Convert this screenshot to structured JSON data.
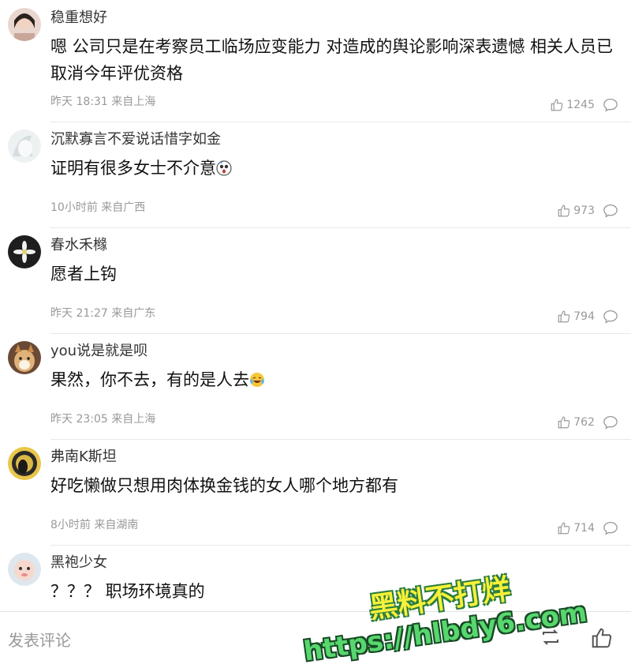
{
  "comments": [
    {
      "username": "稳重想好",
      "content": "嗯 公司只是在考察员工临场应变能力 对造成的舆论影响深表遗憾 相关人员已取消今年评优资格",
      "time": "昨天 18:31",
      "location": "来自上海",
      "likes": "1245"
    },
    {
      "username": "沉默寡言不爱说话惜字如金",
      "content": "证明有很多女士不介意",
      "time": "10小时前",
      "location": "来自广西",
      "likes": "973"
    },
    {
      "username": "春水禾橼",
      "content": "愿者上钩",
      "time": "昨天 21:27",
      "location": "来自广东",
      "likes": "794"
    },
    {
      "username": "you说是就是呗",
      "content": "果然，你不去，有的是人去",
      "time": "昨天 23:05",
      "location": "来自上海",
      "likes": "762"
    },
    {
      "username": "弗南K斯坦",
      "content": "好吃懒做只想用肉体换金钱的女人哪个地方都有",
      "time": "8小时前",
      "location": "来自湖南",
      "likes": "714"
    },
    {
      "username": "黑袍少女",
      "content": "？？？ 职场环境真的",
      "time": "",
      "location": "",
      "likes": ""
    }
  ],
  "bottom_bar": {
    "post_comment_label": "发表评论"
  },
  "watermark": {
    "title": "黑料不打烊",
    "url": "https://hlbdy6.com"
  },
  "icons": {
    "like": "thumbs-up-icon",
    "reply": "speech-bubble-icon",
    "repost": "repost-icon"
  }
}
